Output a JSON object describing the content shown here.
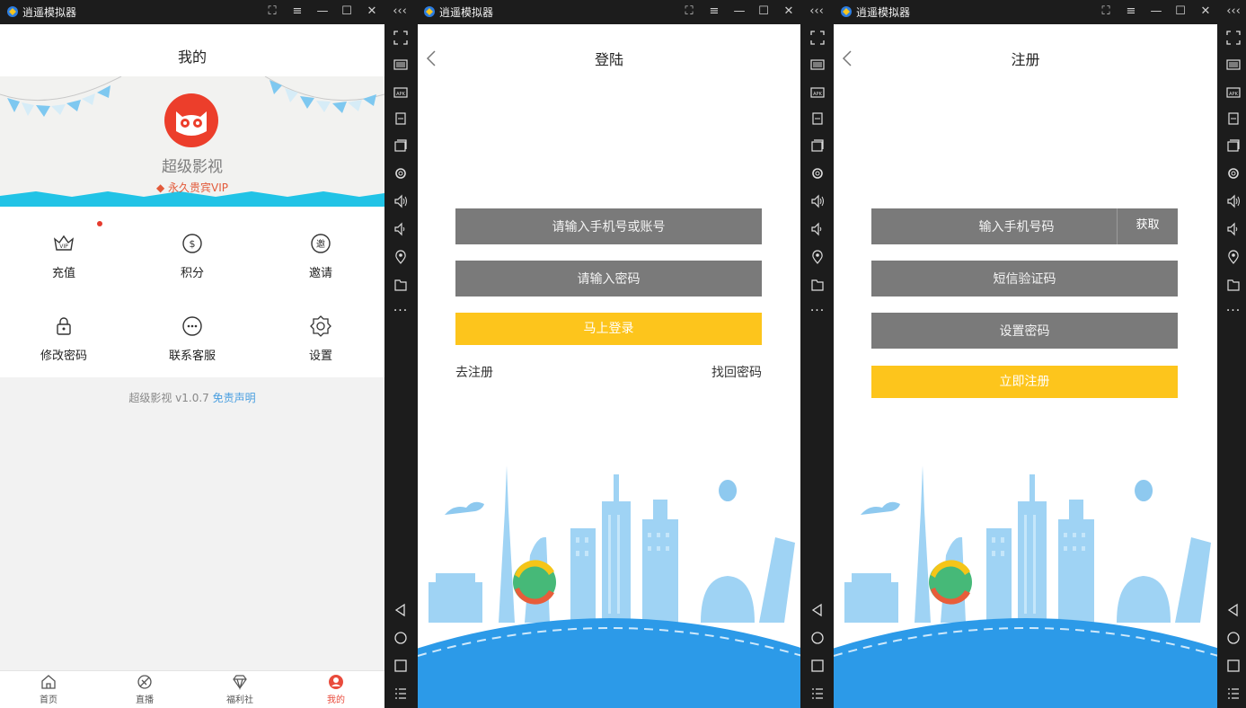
{
  "windows": [
    {
      "app_name": "逍遥模拟器"
    },
    {
      "app_name": "逍遥模拟器"
    },
    {
      "app_name": "逍遥模拟器"
    }
  ],
  "titlebar_icons": [
    "screenshot-icon",
    "menu-icon",
    "minimize-icon",
    "maximize-icon",
    "close-icon"
  ],
  "sidebar_collapse": "‹‹‹",
  "sidebar_more": "···",
  "colors": {
    "accent": "#fdc51c",
    "field_bg": "#7a7a7a",
    "brand_red": "#e94b3c",
    "link_blue": "#4a9fe0"
  },
  "profile": {
    "title": "我的",
    "username": "超级影视",
    "vip_label": "永久贵宾VIP",
    "grid": [
      {
        "label": "充值",
        "icon": "vip-crown-icon"
      },
      {
        "label": "积分",
        "icon": "coin-icon"
      },
      {
        "label": "邀请",
        "icon": "invite-icon"
      },
      {
        "label": "修改密码",
        "icon": "lock-icon"
      },
      {
        "label": "联系客服",
        "icon": "chat-icon"
      },
      {
        "label": "设置",
        "icon": "gear-icon"
      }
    ],
    "version_text": "超级影视 v1.0.7",
    "disclaimer_link": "免责声明",
    "tabs": [
      {
        "label": "首页",
        "icon": "home-icon"
      },
      {
        "label": "直播",
        "icon": "live-icon"
      },
      {
        "label": "福利社",
        "icon": "diamond-icon"
      },
      {
        "label": "我的",
        "icon": "user-icon"
      }
    ]
  },
  "login": {
    "title": "登陆",
    "account_placeholder": "请输入手机号或账号",
    "password_placeholder": "请输入密码",
    "login_button": "马上登录",
    "register_link": "去注册",
    "forgot_link": "找回密码"
  },
  "register": {
    "title": "注册",
    "phone_placeholder": "输入手机号码",
    "get_code_button": "获取",
    "sms_placeholder": "短信验证码",
    "password_placeholder": "设置密码",
    "register_button": "立即注册"
  }
}
